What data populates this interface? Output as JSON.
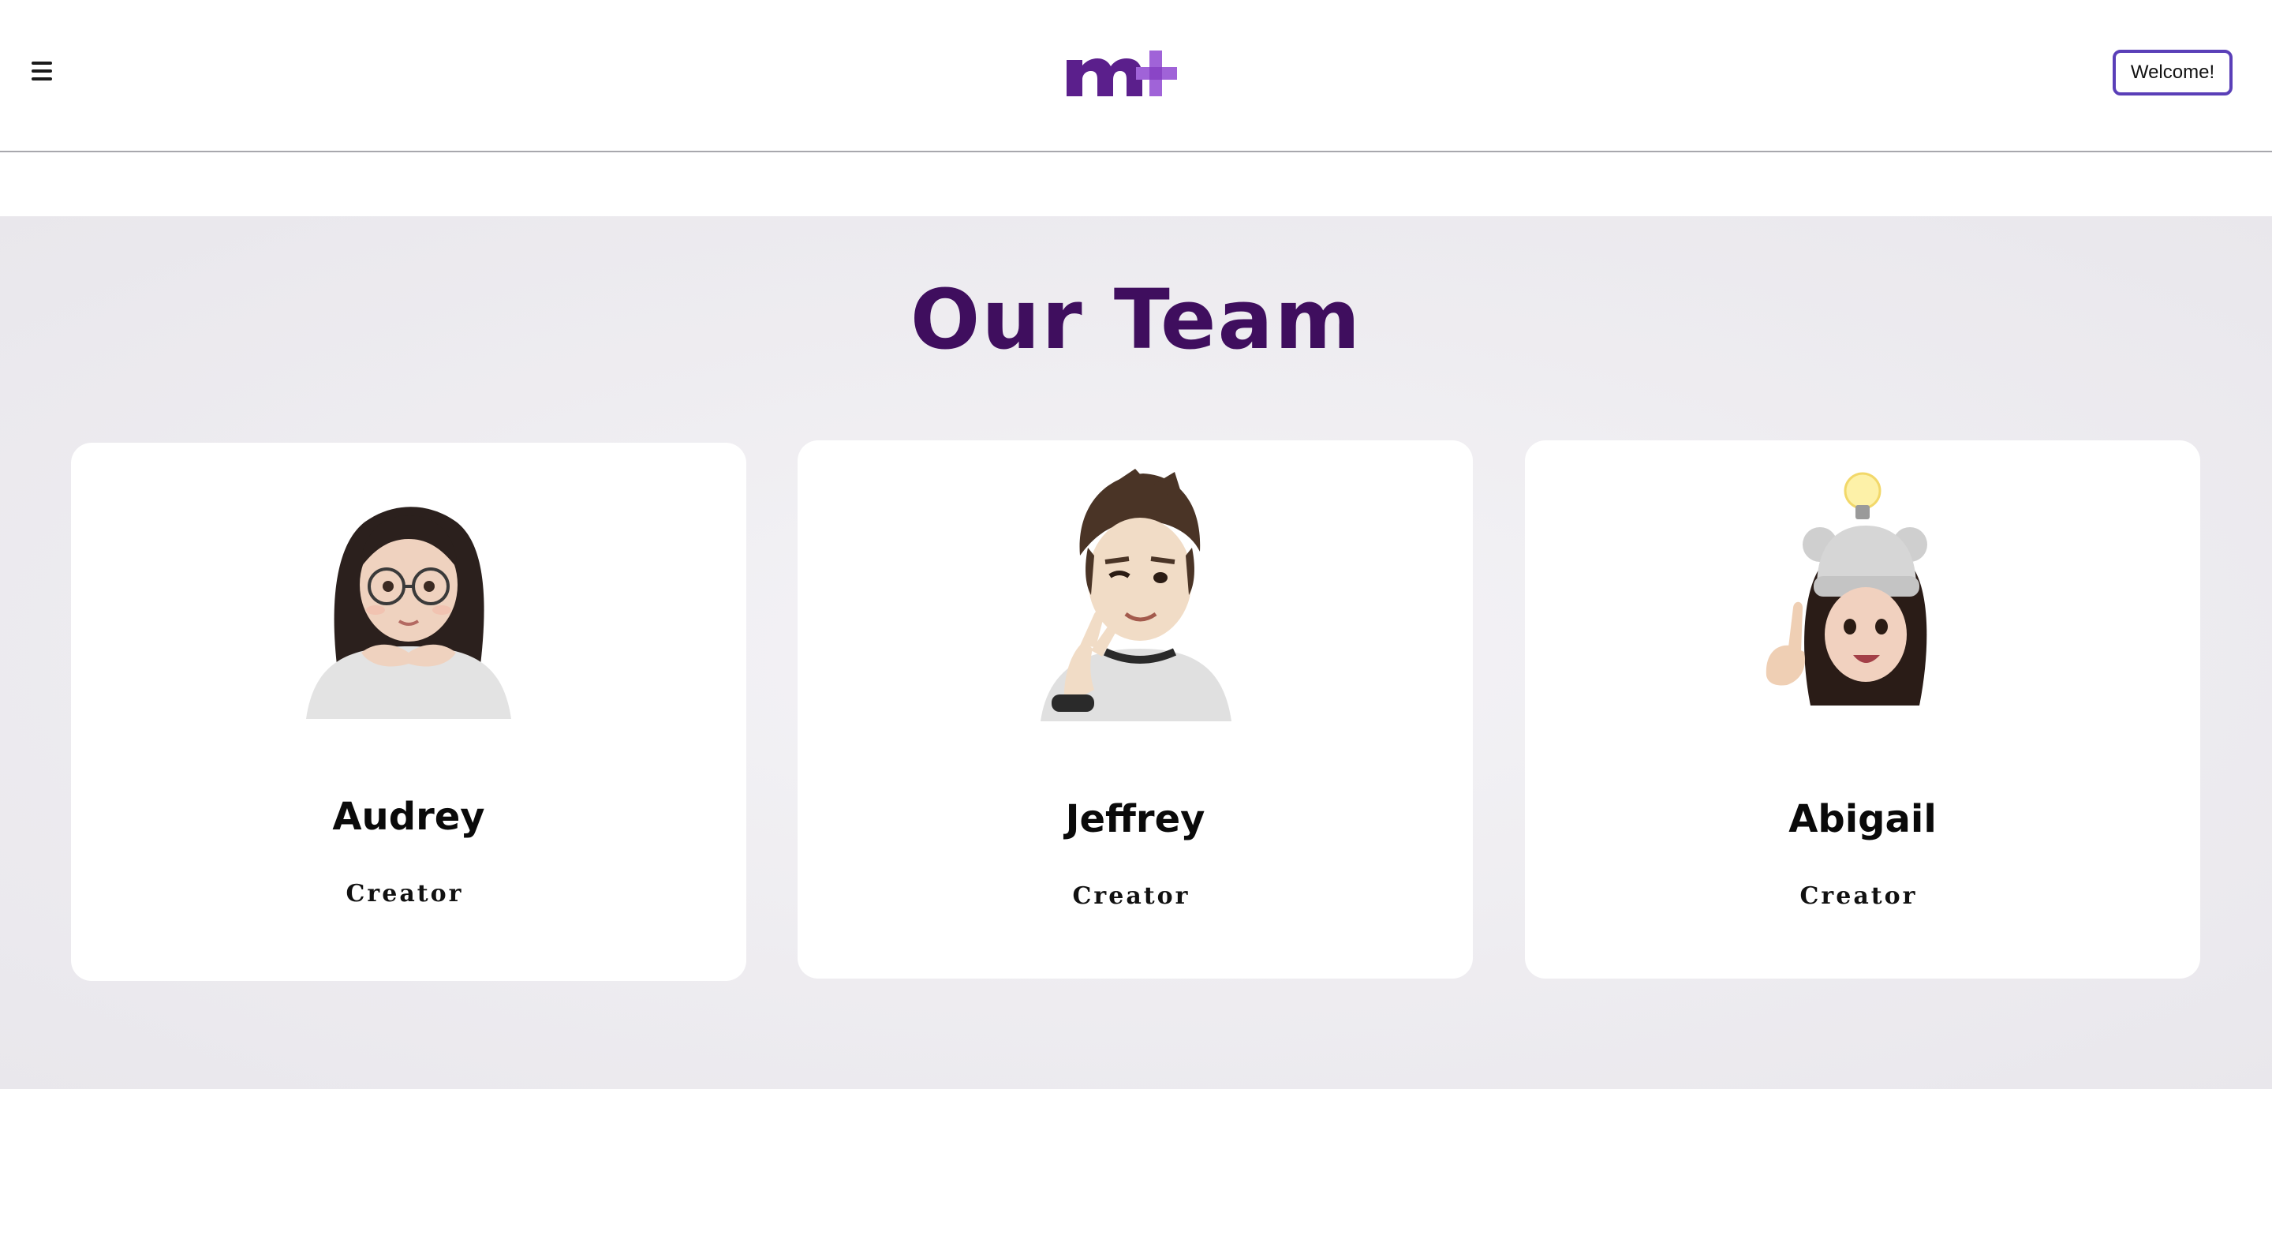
{
  "header": {
    "menu_icon": "hamburger-menu-icon",
    "logo_text": "m+",
    "logo_colors": {
      "m": "#5b1f8c",
      "plus": "#a063d8"
    },
    "welcome_label": "Welcome!"
  },
  "team": {
    "title": "Our Team",
    "title_color": "#3f0e5e",
    "members": [
      {
        "name": "Audrey",
        "role": "Creator",
        "avatar": "memoji-girl-glasses"
      },
      {
        "name": "Jeffrey",
        "role": "Creator",
        "avatar": "memoji-boy-finger-heart"
      },
      {
        "name": "Abigail",
        "role": "Creator",
        "avatar": "memoji-girl-beanie-lightbulb"
      }
    ]
  }
}
